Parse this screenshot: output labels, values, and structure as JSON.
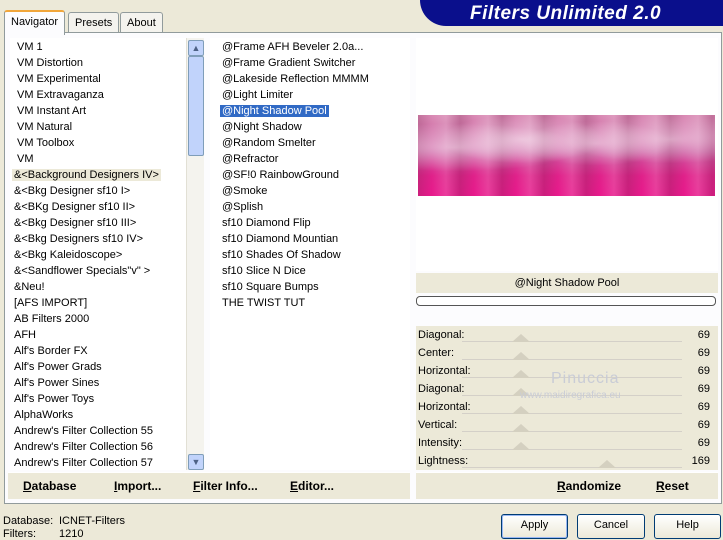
{
  "app": {
    "title": "Filters Unlimited 2.0"
  },
  "tabs": [
    {
      "label": "Navigator"
    },
    {
      "label": "Presets"
    },
    {
      "label": "About"
    }
  ],
  "categories": {
    "items": [
      "VM 1",
      "VM Distortion",
      "VM Experimental",
      "VM Extravaganza",
      "VM Instant Art",
      "VM Natural",
      "VM Toolbox",
      "VM",
      "&<Background Designers IV>",
      "&<Bkg Designer sf10 I>",
      "&<BKg Designer sf10 II>",
      "&<Bkg Designer sf10 III>",
      "&<Bkg Designers sf10 IV>",
      "&<Bkg Kaleidoscope>",
      "&<Sandflower Specials\"v\" >",
      "&Neu!",
      "[AFS IMPORT]",
      "AB Filters 2000",
      "AFH",
      "Alf's Border FX",
      "Alf's Power Grads",
      "Alf's Power Sines",
      "Alf's Power Toys",
      "AlphaWorks",
      "Andrew's Filter Collection 55",
      "Andrew's Filter Collection 56",
      "Andrew's Filter Collection 57"
    ],
    "selected_index": 8
  },
  "filters": {
    "items": [
      "@Frame AFH Beveler 2.0a...",
      "@Frame Gradient Switcher",
      "@Lakeside Reflection MMMM",
      "@Light Limiter",
      "@Night Shadow Pool",
      "@Night Shadow",
      "@Random Smelter",
      "@Refractor",
      "@SF!0 RainbowGround",
      "@Smoke",
      "@Splish",
      "sf10 Diamond Flip",
      "sf10 Diamond Mountian",
      "sf10 Shades Of Shadow",
      "sf10 Slice N Dice",
      "sf10 Square Bumps",
      "THE TWIST TUT"
    ],
    "selected_index": 4
  },
  "preview": {
    "filter_name": "@Night Shadow Pool",
    "progress": 0
  },
  "params": [
    {
      "label": "Diagonal:",
      "value": "69",
      "level": 0.27
    },
    {
      "label": "Center:",
      "value": "69",
      "level": 0.27
    },
    {
      "label": "Horizontal:",
      "value": "69",
      "level": 0.27
    },
    {
      "label": "Diagonal:",
      "value": "69",
      "level": 0.27
    },
    {
      "label": "Horizontal:",
      "value": "69",
      "level": 0.27
    },
    {
      "label": "Vertical:",
      "value": "69",
      "level": 0.27
    },
    {
      "label": "Intensity:",
      "value": "69",
      "level": 0.27
    },
    {
      "label": "Lightness:",
      "value": "169",
      "level": 0.66
    }
  ],
  "watermark": {
    "line1": "Pinuccia",
    "line2": "www.maidiregrafica.eu"
  },
  "toolbar_left": {
    "database": "Database",
    "import": "Import...",
    "filter_info": "Filter Info...",
    "editor": "Editor..."
  },
  "toolbar_right": {
    "randomize": "Randomize",
    "reset": "Reset"
  },
  "status": {
    "database_label": "Database:",
    "database_value": "ICNET-Filters",
    "filters_label": "Filters:",
    "filters_value": "1210"
  },
  "buttons": {
    "apply": "Apply",
    "cancel": "Cancel",
    "help": "Help"
  },
  "colors": {
    "banner": "#0a0f8c",
    "selection_blue": "#316ac5",
    "preview_pink": "#e8198c"
  }
}
